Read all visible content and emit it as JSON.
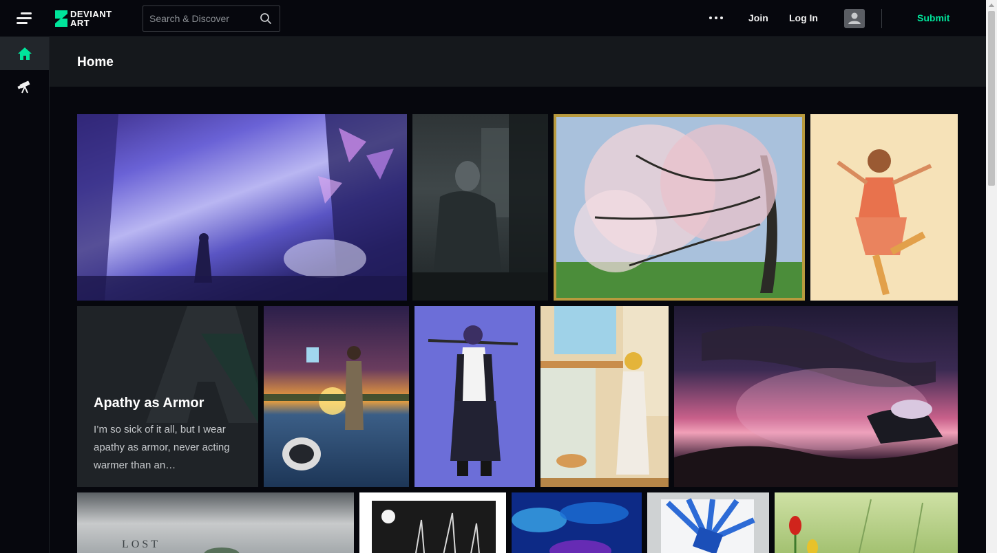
{
  "topbar": {
    "logo_line1": "DEVIANT",
    "logo_line2": "ART",
    "search_placeholder": "Search & Discover",
    "join_label": "Join",
    "login_label": "Log In",
    "submit_label": "Submit"
  },
  "colors": {
    "accent": "#00e59b",
    "background": "#06070d",
    "header_bg": "#15181c"
  },
  "rail": {
    "items": [
      {
        "icon": "home-icon",
        "active": true
      },
      {
        "icon": "telescope-icon",
        "active": false
      }
    ]
  },
  "page": {
    "title": "Home"
  },
  "literature": {
    "title": "Apathy as Armor",
    "excerpt": "I’m so sick of it all, but I wear apathy as armor, never acting warmer than an…"
  }
}
